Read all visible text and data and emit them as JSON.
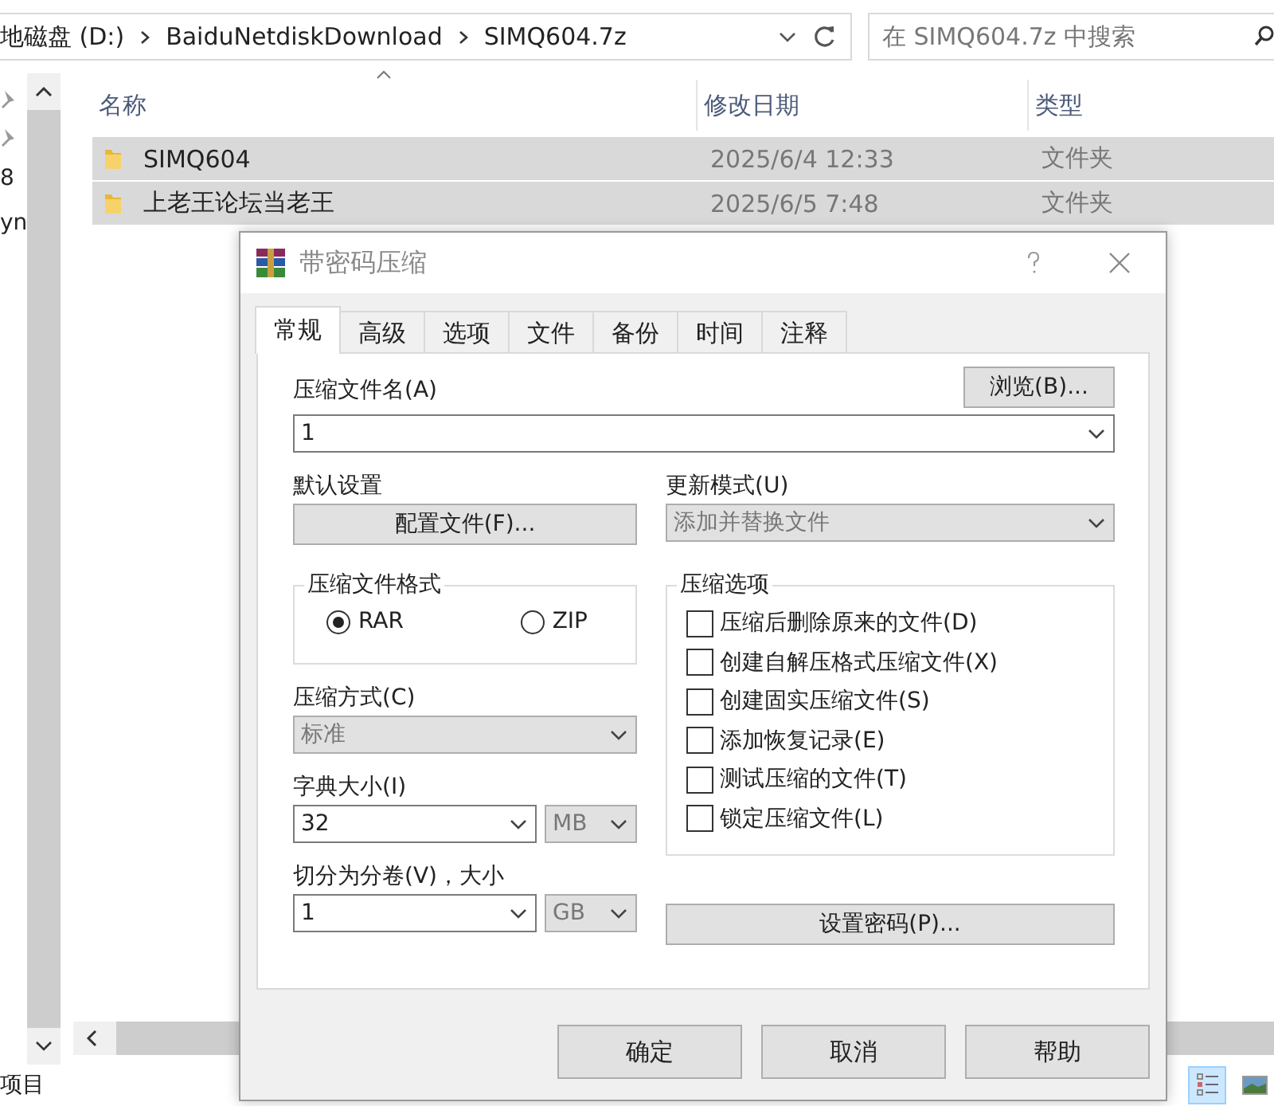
{
  "explorer": {
    "breadcrumbs": [
      "地磁盘 (D:)",
      "BaiduNetdiskDownload",
      "SIMQ604.7z"
    ],
    "search": {
      "placeholder": "在 SIMQ604.7z 中搜索"
    },
    "nav_pane": {
      "texts": [
        "8",
        "yn"
      ]
    },
    "columns": [
      "名称",
      "修改日期",
      "类型"
    ],
    "rows": [
      {
        "name": "SIMQ604",
        "date": "2025/6/4 12:33",
        "type": "文件夹",
        "selected": true
      },
      {
        "name": "上老王论坛当老王",
        "date": "2025/6/5 7:48",
        "type": "文件夹",
        "selected": true
      }
    ],
    "status_bar": "项目"
  },
  "dialog": {
    "title": "带密码压缩",
    "tabs": [
      {
        "label": "常规",
        "selected": true
      },
      {
        "label": "高级",
        "selected": false
      },
      {
        "label": "选项",
        "selected": false
      },
      {
        "label": "文件",
        "selected": false
      },
      {
        "label": "备份",
        "selected": false
      },
      {
        "label": "时间",
        "selected": false
      },
      {
        "label": "注释",
        "selected": false
      }
    ],
    "archive_name": {
      "label": "压缩文件名(A)",
      "value": "1",
      "browse": "浏览(B)..."
    },
    "default_settings": {
      "label": "默认设置",
      "button": "配置文件(F)..."
    },
    "update_mode": {
      "label": "更新模式(U)",
      "value": "添加并替换文件"
    },
    "format": {
      "title": "压缩文件格式",
      "options": [
        {
          "label": "RAR",
          "selected": true
        },
        {
          "label": "ZIP",
          "selected": false
        }
      ]
    },
    "method": {
      "label": "压缩方式(C)",
      "value": "标准"
    },
    "dictionary": {
      "label": "字典大小(I)",
      "value": "32",
      "unit": "MB"
    },
    "volumes": {
      "label": "切分为分卷(V)，大小",
      "value": "1",
      "unit": "GB"
    },
    "options": {
      "title": "压缩选项",
      "items": [
        {
          "label": "压缩后删除原来的文件(D)",
          "checked": false
        },
        {
          "label": "创建自解压格式压缩文件(X)",
          "checked": false
        },
        {
          "label": "创建固实压缩文件(S)",
          "checked": false
        },
        {
          "label": "添加恢复记录(E)",
          "checked": false
        },
        {
          "label": "测试压缩的文件(T)",
          "checked": false
        },
        {
          "label": "锁定压缩文件(L)",
          "checked": false
        }
      ]
    },
    "password_button": "设置密码(P)...",
    "buttons": [
      "确定",
      "取消",
      "帮助"
    ]
  }
}
